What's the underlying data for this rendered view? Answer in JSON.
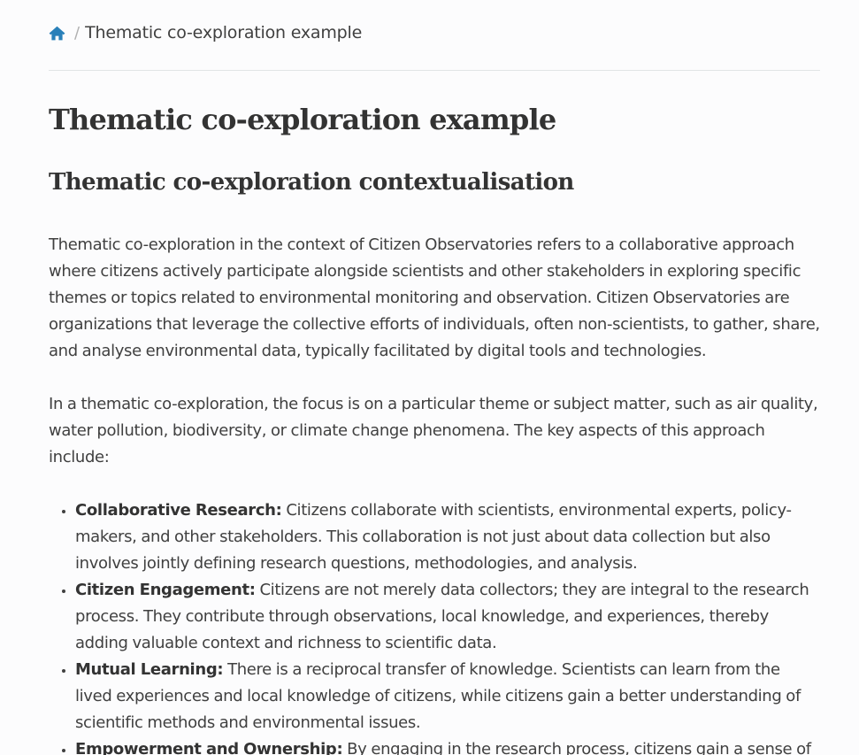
{
  "breadcrumb": {
    "home_icon": "home-icon",
    "separator": "/",
    "current": "Thematic co-exploration example"
  },
  "page": {
    "title": "Thematic co-exploration example",
    "section_title": "Thematic co-exploration contextualisation",
    "paragraphs": [
      "Thematic co-exploration in the context of Citizen Observatories refers to a collaborative approach where citizens actively participate alongside scientists and other stakeholders in exploring specific themes or topics related to environmental monitoring and observation. Citizen Observatories are organizations that leverage the collective efforts of individuals, often non-scientists, to gather, share, and analyse environmental data, typically facilitated by digital tools and technologies.",
      "In a thematic co-exploration, the focus is on a particular theme or subject matter, such as air quality, water pollution, biodiversity, or climate change phenomena. The key aspects of this approach include:"
    ],
    "aspects": [
      {
        "term": "Collaborative Research:",
        "text": " Citizens collaborate with scientists, environmental experts, policy-makers, and other stakeholders. This collaboration is not just about data collection but also involves jointly defining research questions, methodologies, and analysis."
      },
      {
        "term": "Citizen Engagement:",
        "text": " Citizens are not merely data collectors; they are integral to the research process. They contribute through observations, local knowledge, and experiences, thereby adding valuable context and richness to scientific data."
      },
      {
        "term": "Mutual Learning:",
        "text": " There is a reciprocal transfer of knowledge. Scientists can learn from the lived experiences and local knowledge of citizens, while citizens gain a better understanding of scientific methods and environmental issues."
      },
      {
        "term": "Empowerment and Ownership:",
        "text": " By engaging in the research process, citizens gain a sense of"
      }
    ]
  },
  "colors": {
    "link_blue": "#2980b9",
    "text": "#404040",
    "heading": "#333333",
    "divider": "#e1e4e5"
  }
}
